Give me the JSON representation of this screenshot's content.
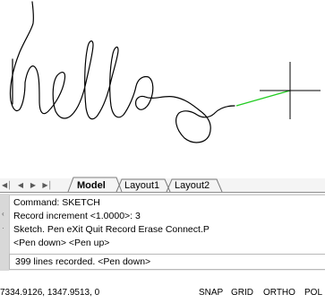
{
  "drawing": {
    "handwriting": "hello"
  },
  "layout_tabs": {
    "nav": [
      "first-tab",
      "previous-tab",
      "next-tab",
      "last-tab"
    ],
    "tabs": [
      {
        "label": "Model",
        "active": true
      },
      {
        "label": "Layout1",
        "active": false
      },
      {
        "label": "Layout2",
        "active": false
      }
    ]
  },
  "command_window": {
    "history": [
      "Command: SKETCH",
      "Record increment <1.0000>: 3",
      "Sketch. Pen eXit Quit Record Erase Connect.P",
      " <Pen down>  <Pen up>"
    ],
    "current_line": "399 lines recorded. <Pen down>"
  },
  "status_bar": {
    "coordinates": "7334.9126, 1347.9513, 0",
    "buttons": [
      "SNAP",
      "GRID",
      "ORTHO",
      "POL"
    ]
  },
  "colors": {
    "sketch_line": "#000000",
    "rubber_band": "#22cc22",
    "cursor": "#000000"
  }
}
